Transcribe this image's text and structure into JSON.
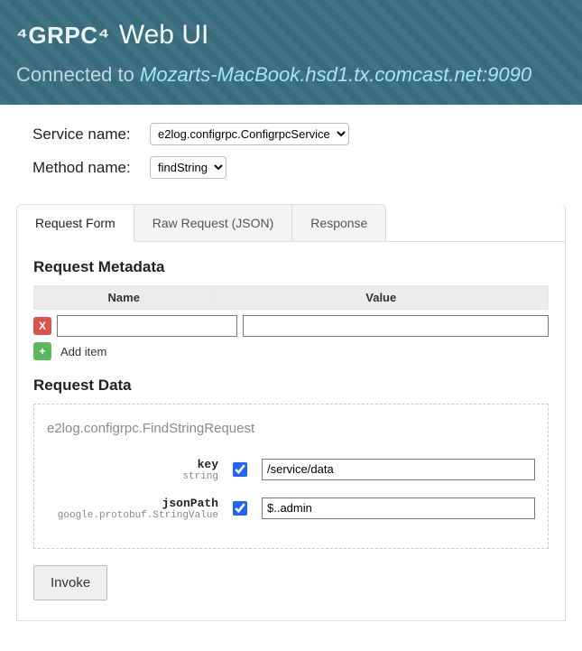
{
  "header": {
    "logo": "⁴GRPC⁴",
    "title": "Web UI",
    "connected_label": "Connected to",
    "target": "Mozarts-MacBook.hsd1.tx.comcast.net:9090"
  },
  "controls": {
    "service_label": "Service name:",
    "service_value": "e2log.configrpc.ConfigrpcService",
    "method_label": "Method name:",
    "method_value": "findString"
  },
  "tabs": {
    "form": "Request Form",
    "raw": "Raw Request (JSON)",
    "response": "Response"
  },
  "metadata": {
    "title": "Request Metadata",
    "col_name": "Name",
    "col_value": "Value",
    "rows": [
      {
        "name": "",
        "value": ""
      }
    ],
    "delete_icon": "X",
    "add_icon": "+",
    "add_label": "Add item"
  },
  "request_data": {
    "title": "Request Data",
    "request_type": "e2log.configrpc.FindStringRequest",
    "fields": [
      {
        "name": "key",
        "type": "string",
        "enabled": true,
        "value": "/service/data"
      },
      {
        "name": "jsonPath",
        "type": "google.protobuf.StringValue",
        "enabled": true,
        "value": "$..admin"
      }
    ]
  },
  "invoke_label": "Invoke"
}
